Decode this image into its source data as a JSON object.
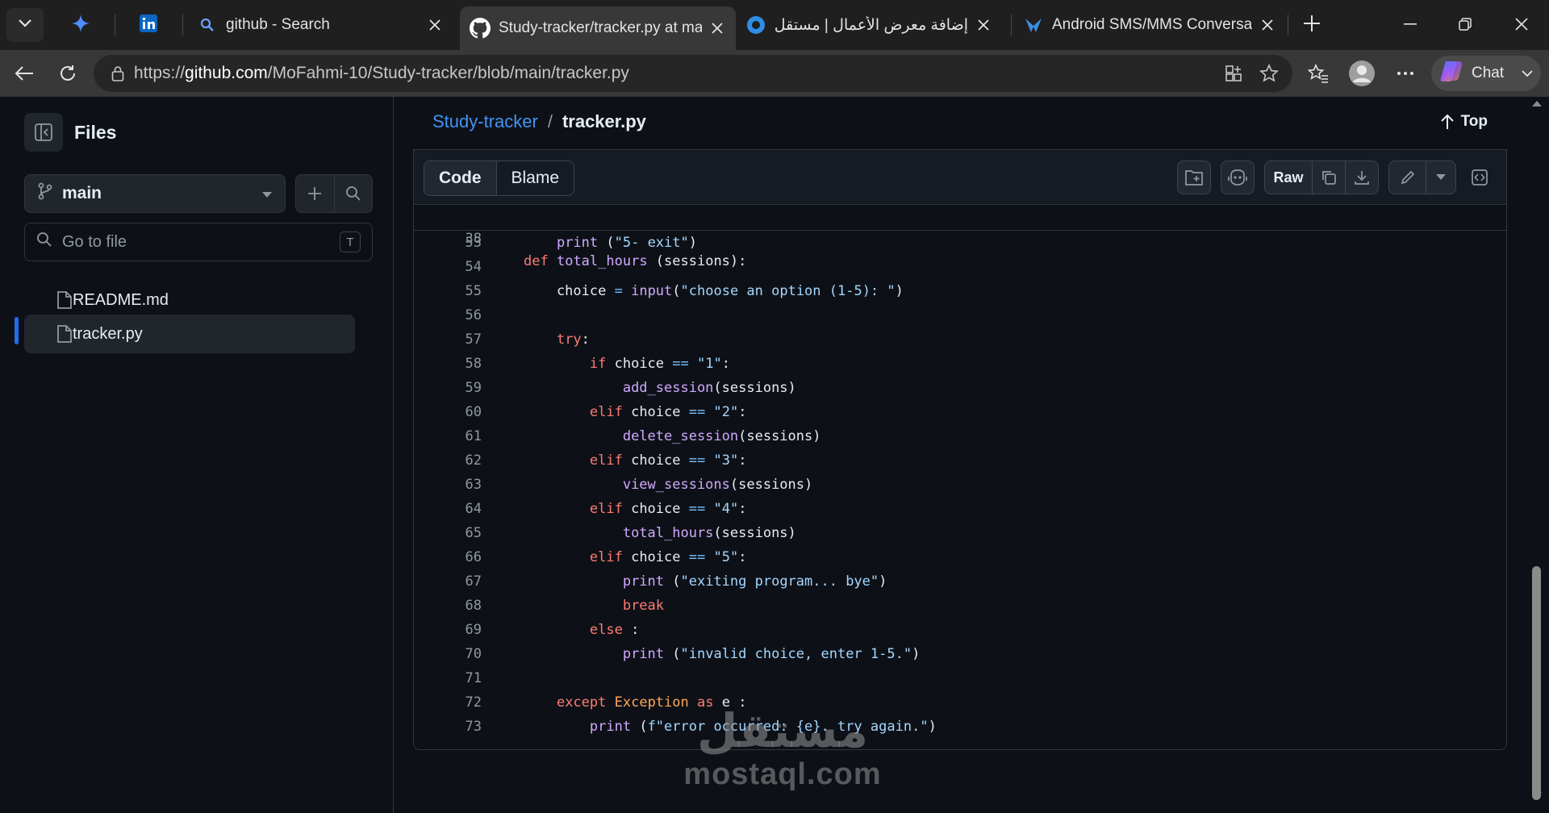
{
  "browser": {
    "tabs": [
      {
        "title": "github - Search",
        "active": false
      },
      {
        "title": "Study-tracker/tracker.py at main",
        "active": true
      },
      {
        "title": "إضافة معرض الأعمال | مستقل",
        "active": false
      },
      {
        "title": "Android SMS/MMS Conversation",
        "active": false
      }
    ],
    "url_prefix": "https://",
    "url_host": "github.com",
    "url_path": "/MoFahmi-10/Study-tracker/blob/main/tracker.py",
    "chat_label": "Chat"
  },
  "sidebar": {
    "title": "Files",
    "branch": "main",
    "goto_placeholder": "Go to file",
    "goto_shortcut": "T",
    "files": [
      {
        "name": "README.md",
        "selected": false
      },
      {
        "name": "tracker.py",
        "selected": true
      }
    ]
  },
  "file": {
    "repo": "Study-tracker",
    "separator": "/",
    "name": "tracker.py",
    "top_label": "Top",
    "view_tabs": [
      "Code",
      "Blame"
    ],
    "raw_label": "Raw"
  },
  "code": {
    "sticky": {
      "num": "38",
      "text": "def total_hours (sessions):"
    },
    "lines": [
      {
        "num": "53",
        "text": "    print (\"5- exit\")"
      },
      {
        "num": "54",
        "text": ""
      },
      {
        "num": "55",
        "text": "    choice = input(\"choose an option (1-5): \")"
      },
      {
        "num": "56",
        "text": ""
      },
      {
        "num": "57",
        "text": "    try:"
      },
      {
        "num": "58",
        "text": "        if choice == \"1\":"
      },
      {
        "num": "59",
        "text": "            add_session(sessions)"
      },
      {
        "num": "60",
        "text": "        elif choice == \"2\":"
      },
      {
        "num": "61",
        "text": "            delete_session(sessions)"
      },
      {
        "num": "62",
        "text": "        elif choice == \"3\":"
      },
      {
        "num": "63",
        "text": "            view_sessions(sessions)"
      },
      {
        "num": "64",
        "text": "        elif choice == \"4\":"
      },
      {
        "num": "65",
        "text": "            total_hours(sessions)"
      },
      {
        "num": "66",
        "text": "        elif choice == \"5\":"
      },
      {
        "num": "67",
        "text": "            print (\"exiting program... bye\")"
      },
      {
        "num": "68",
        "text": "            break"
      },
      {
        "num": "69",
        "text": "        else :"
      },
      {
        "num": "70",
        "text": "            print (\"invalid choice, enter 1-5.\")"
      },
      {
        "num": "71",
        "text": ""
      },
      {
        "num": "72",
        "text": "    except Exception as e :"
      },
      {
        "num": "73",
        "text": "        print (f\"error occurred: {e}. try again.\")"
      }
    ]
  },
  "watermark": {
    "arabic": "مستقل",
    "latin": "mostaql.com"
  },
  "colors": {
    "link": "#4493f8",
    "keyword": "#ff7b72",
    "function": "#d2a8ff",
    "string": "#a5d6ff",
    "bg": "#0d1117"
  }
}
